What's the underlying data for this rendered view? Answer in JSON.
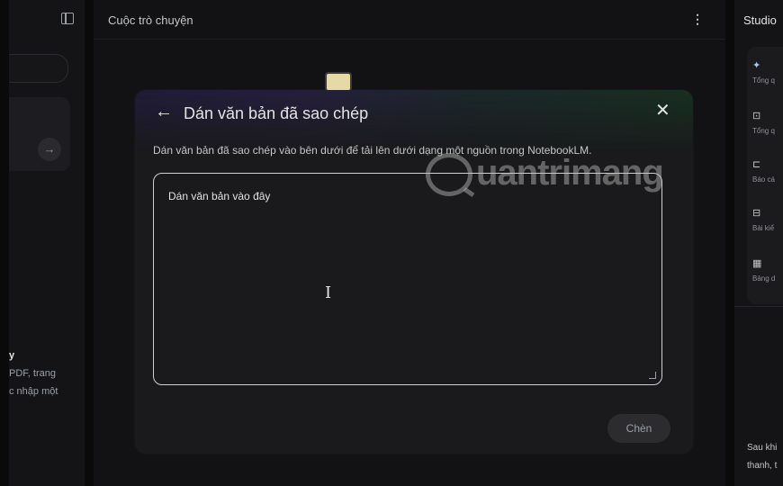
{
  "left_panel": {
    "arrow": "→",
    "lines": [
      "y",
      "PDF, trang",
      "c nhập một"
    ]
  },
  "chat": {
    "title": "Cuộc trò chuyện",
    "menu": "⋮"
  },
  "studio": {
    "title": "Studio",
    "items": [
      {
        "icon": "sparkle-icon",
        "glyph": "✦",
        "label": "Tổng q"
      },
      {
        "icon": "audio-overview-icon",
        "glyph": "⊡",
        "label": "Tổng q"
      },
      {
        "icon": "report-icon",
        "glyph": "⊏",
        "label": "Báo cá"
      },
      {
        "icon": "quiz-icon",
        "glyph": "⊟",
        "label": "Bài kiể"
      },
      {
        "icon": "table-icon",
        "glyph": "▦",
        "label": "Bảng d"
      }
    ],
    "footer": [
      "Sau khi",
      "thanh, t"
    ]
  },
  "dialog": {
    "back": "←",
    "title": "Dán văn bản đã sao chép",
    "close": "✕",
    "description": "Dán văn bản đã sao chép vào bên dưới để tải lên dưới dạng một nguồn trong NotebookLM.",
    "placeholder": "Dán văn bản vào đây",
    "cursor": "I",
    "insert_label": "Chèn"
  },
  "watermark": {
    "text": "uantrimang"
  }
}
